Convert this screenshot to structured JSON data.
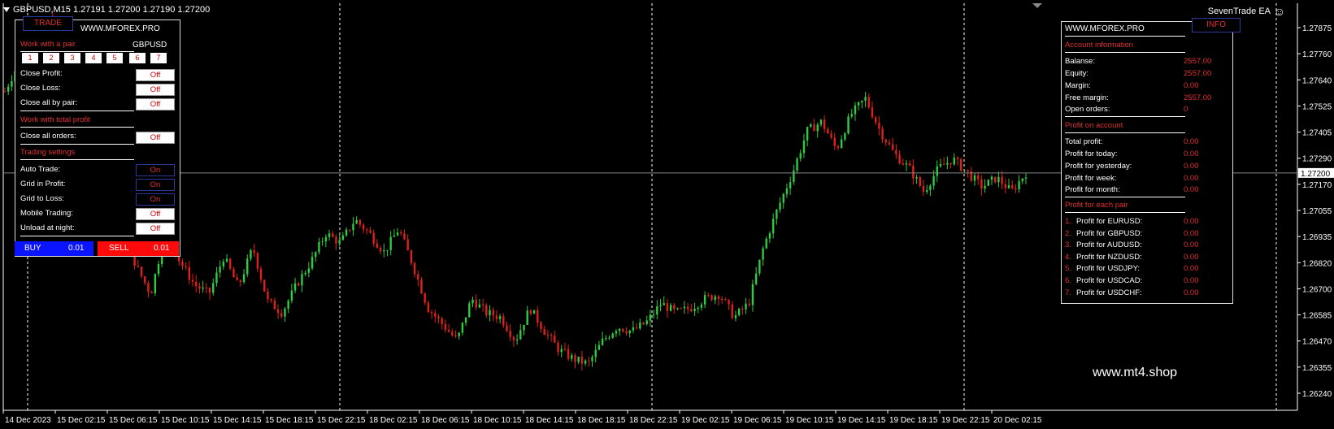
{
  "header": {
    "symbol_line": "GBPUSD,M15  1.27191 1.27200 1.27190 1.27200",
    "ea_name": "SevenTrade EA",
    "smile_icon": "smiley-icon"
  },
  "watermark": "www.mt4.shop",
  "price_axis": {
    "labels": [
      "1.27875",
      "1.27760",
      "1.27640",
      "1.27525",
      "1.27405",
      "1.27290",
      "1.27200",
      "1.27170",
      "1.27055",
      "1.26935",
      "1.26820",
      "1.26700",
      "1.26585",
      "1.26470",
      "1.26355",
      "1.26240"
    ],
    "current_price": "1.27200"
  },
  "time_axis": [
    "14 Dec 2023",
    "15 Dec 02:15",
    "15 Dec 06:15",
    "15 Dec 10:15",
    "15 Dec 14:15",
    "15 Dec 18:15",
    "15 Dec 22:15",
    "18 Dec 02:15",
    "18 Dec 06:15",
    "18 Dec 10:15",
    "18 Dec 14:15",
    "18 Dec 18:15",
    "18 Dec 22:15",
    "19 Dec 02:15",
    "19 Dec 06:15",
    "19 Dec 10:15",
    "19 Dec 14:15",
    "19 Dec 18:15",
    "19 Dec 22:15",
    "20 Dec 02:15"
  ],
  "chart_data": {
    "type": "candlestick",
    "symbol": "GBPUSD",
    "timeframe": "M15",
    "ylim": [
      1.2624,
      1.2788
    ],
    "bull_color": "#2ecc40",
    "bear_color": "#e0201a",
    "close_path": [
      1.2755,
      1.2768,
      1.276,
      1.2785,
      1.2776,
      1.2762,
      1.2735,
      1.2718,
      1.2698,
      1.268,
      1.2668,
      1.2695,
      1.2682,
      1.2672,
      1.2668,
      1.2684,
      1.2671,
      1.2688,
      1.2665,
      1.266,
      1.2672,
      1.2682,
      1.2694,
      1.269,
      1.27,
      1.2694,
      1.2686,
      1.2696,
      1.268,
      1.2662,
      1.2655,
      1.2648,
      1.2666,
      1.266,
      1.2658,
      1.2648,
      1.2662,
      1.2652,
      1.2644,
      1.264,
      1.2638,
      1.2648,
      1.2654,
      1.2652,
      1.2656,
      1.2664,
      1.266,
      1.2662,
      1.2666,
      1.2668,
      1.2658,
      1.2664,
      1.2688,
      1.2705,
      1.272,
      1.2738,
      1.2742,
      1.273,
      1.2745,
      1.2752,
      1.2738,
      1.2728,
      1.2722,
      1.2712,
      1.2722,
      1.2726,
      1.272,
      1.2714,
      1.2718,
      1.2712,
      1.272
    ]
  },
  "trade_panel": {
    "tab": "TRADE",
    "site": "WWW.MFOREX.PRO",
    "work_pair": "Work with a pair",
    "pair": "GBPUSD",
    "numbers": [
      "1",
      "2",
      "3",
      "4",
      "5",
      "6",
      "7"
    ],
    "close_profit": "Close Profit:",
    "close_loss": "Close Loss:",
    "close_all_pair": "Close all by pair:",
    "work_total": "Work with total profit",
    "close_all_orders": "Close all orders:",
    "trading_settings": "Trading settings",
    "auto_trade": "Auto Trade:",
    "grid_profit": "Grid in Profit:",
    "grid_loss": "Grid to Loss:",
    "mobile_trading": "Mobile Trading:",
    "unload_night": "Unload at night:",
    "toggles": {
      "close_profit": "Off",
      "close_loss": "Off",
      "close_all_pair": "Off",
      "close_all_orders": "Off",
      "auto_trade": "On",
      "grid_profit": "On",
      "grid_loss": "On",
      "mobile_trading": "Off",
      "unload_night": "Off"
    },
    "buy": "BUY",
    "buy_lot": "0.01",
    "sell": "SELL",
    "sell_lot": "0.01"
  },
  "info_panel": {
    "tab": "INFO",
    "site": "WWW.MFOREX.PRO",
    "account_info": "Account information",
    "balance": "Balanse:",
    "balance_val": "2557.00",
    "equity": "Equity:",
    "equity_val": "2557.00",
    "margin": "Margin:",
    "margin_val": "0.00",
    "free_margin": "Free margin:",
    "free_margin_val": "2557.00",
    "open_orders": "Open orders:",
    "open_orders_val": "0",
    "profit_account": "Profit on account",
    "total_profit": "Total profit:",
    "total_profit_val": "0.00",
    "profit_today": "Profit for today:",
    "profit_today_val": "0.00",
    "profit_yesterday": "Profit for yesterday:",
    "profit_yesterday_val": "0.00",
    "profit_week": "Profit for week:",
    "profit_week_val": "0.00",
    "profit_month": "Profit for month:",
    "profit_month_val": "0.00",
    "profit_each_pair": "Profit for each pair",
    "pairs": [
      {
        "n": "1.",
        "label": "Profit for EURUSD:",
        "val": "0.00"
      },
      {
        "n": "2.",
        "label": "Profit for GBPUSD:",
        "val": "0.00"
      },
      {
        "n": "3.",
        "label": "Profit for AUDUSD:",
        "val": "0.00"
      },
      {
        "n": "4.",
        "label": "Profit for NZDUSD:",
        "val": "0.00"
      },
      {
        "n": "5.",
        "label": "Profit for USDJPY:",
        "val": "0.00"
      },
      {
        "n": "6.",
        "label": "Profit for USDCAD:",
        "val": "0.00"
      },
      {
        "n": "7.",
        "label": "Profit for USDCHF:",
        "val": "0.00"
      }
    ]
  }
}
